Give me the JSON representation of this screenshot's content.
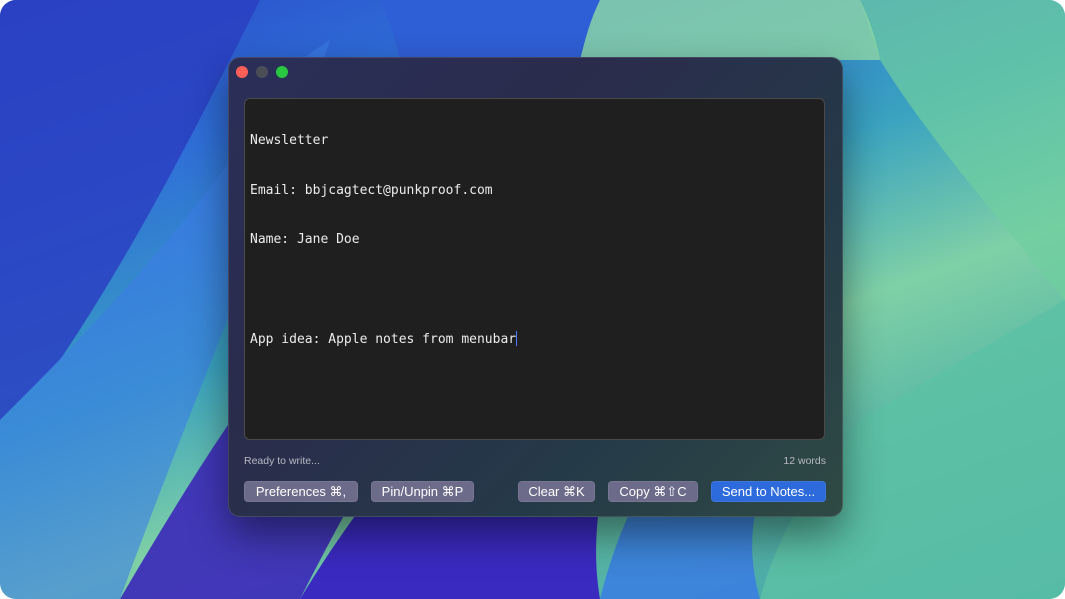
{
  "window": {
    "traffic_lights": [
      "close",
      "minimize",
      "zoom"
    ]
  },
  "editor": {
    "lines": [
      "Newsletter",
      "Email: bbjcagtect@punkproof.com",
      "Name: Jane Doe",
      "",
      "App idea: Apple notes from menubar"
    ]
  },
  "status": {
    "message": "Ready to write...",
    "word_count": "12 words"
  },
  "buttons": {
    "preferences": "Preferences ⌘,",
    "pin": "Pin/Unpin ⌘P",
    "clear": "Clear ⌘K",
    "copy": "Copy ⌘⇧C",
    "send": "Send to Notes..."
  },
  "colors": {
    "close": "#ff5f57",
    "zoom": "#28c840",
    "primary_button": "#2d6bdc",
    "secondary_button": "#6d6b8a"
  }
}
